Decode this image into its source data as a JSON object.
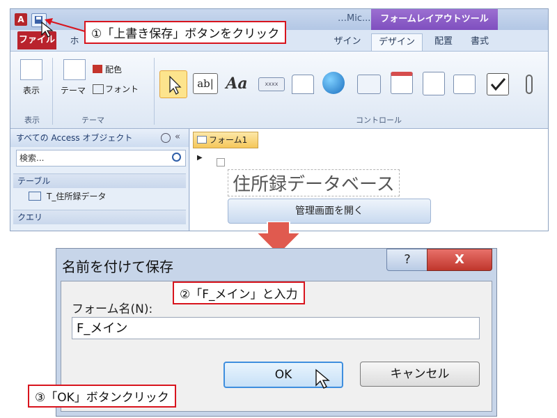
{
  "titlebar": {
    "app_icon_letter": "A",
    "title_fragment": "…Mic...",
    "context_tab_header": "フォームレイアウトツール"
  },
  "ribbon_tabs": {
    "file": "ファイル",
    "home": "ホ",
    "design": "デザイン",
    "arrange": "配置",
    "format": "書式",
    "cut_label": "ザイン"
  },
  "ribbon": {
    "view_label": "表示",
    "view_group": "表示",
    "theme_label": "テーマ",
    "colors_label": "配色",
    "fonts_label": "フォント",
    "theme_group": "テーマ",
    "controls_group": "コントロール",
    "textbox_glyph": "ab|",
    "label_glyph": "Aa",
    "button_glyph": "xxxx"
  },
  "nav": {
    "header": "すべての Access オブジェクト",
    "search_placeholder": "検索...",
    "group_tables": "テーブル",
    "table_item": "T_住所録データ",
    "group_queries": "クエリ"
  },
  "form": {
    "doc_tab": "フォーム1",
    "title_label": "住所録データベース",
    "button_label": "管理画面を開く"
  },
  "callouts": {
    "step1": "①「上書き保存」ボタンをクリック",
    "step2": "②「F_メイン」と入力",
    "step3": "③「OK」ボタンクリック"
  },
  "dialog": {
    "title": "名前を付けて保存",
    "help": "?",
    "close": "X",
    "field_label": "フォーム名(N):",
    "field_value": "F_メイン",
    "ok": "OK",
    "cancel": "キャンセル"
  },
  "colors": {
    "callout_border": "#d8141d",
    "arrow": "#e05a4f",
    "file_tab": "#b9232d",
    "context_tab": "#8656c6"
  }
}
